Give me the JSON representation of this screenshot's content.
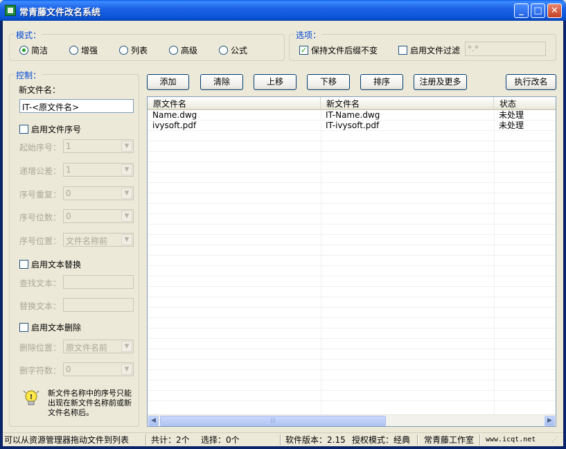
{
  "window": {
    "title": "常青藤文件改名系统",
    "minimize": "_",
    "maximize": "□",
    "close": "✕"
  },
  "mode": {
    "group_label": "模式：",
    "options": [
      "简洁",
      "增强",
      "列表",
      "高级",
      "公式"
    ],
    "selected": "简洁"
  },
  "options": {
    "group_label": "选项：",
    "keep_ext_label": "保持文件后缀不变",
    "keep_ext_checked": true,
    "filter_label": "启用文件过滤",
    "filter_checked": false,
    "filter_value": "*.*"
  },
  "control": {
    "group_label": "控制：",
    "new_name_label": "新文件名：",
    "new_name_value": "IT-<原文件名>",
    "enable_seq_label": "启用文件序号",
    "start_seq_label": "起始序号：",
    "start_seq_value": "1",
    "increment_label": "递增公差：",
    "increment_value": "1",
    "repeat_label": "序号重复：",
    "repeat_value": "0",
    "digits_label": "序号位数：",
    "digits_value": "0",
    "position_label": "序号位置：",
    "position_value": "文件名称前",
    "enable_replace_label": "启用文本替换",
    "find_label": "查找文本：",
    "replace_label": "替换文本：",
    "enable_delete_label": "启用文本删除",
    "delete_pos_label": "删除位置：",
    "delete_pos_value": "原文件名前",
    "delete_count_label": "删字符数：",
    "delete_count_value": "0",
    "hint": "新文件名称中的序号只能出现在新文件名称前或新文件名称后。"
  },
  "toolbar": {
    "add": "添加",
    "clear": "清除",
    "up": "上移",
    "down": "下移",
    "sort": "排序",
    "register": "注册及更多",
    "execute": "执行改名"
  },
  "list": {
    "columns": [
      "原文件名",
      "新文件名",
      "状态"
    ],
    "rows": [
      [
        "Name.dwg",
        "IT-Name.dwg",
        "未处理"
      ],
      [
        "ivysoft.pdf",
        "IT-ivysoft.pdf",
        "未处理"
      ]
    ]
  },
  "statusbar": {
    "hint": "可以从资源管理器拖动文件到列表",
    "total": "共计：2个",
    "selected": "选择：0个",
    "version": "软件版本：2.15",
    "license": "授权模式：经典",
    "studio": "常青藤工作室",
    "website": "www.icqt.net"
  },
  "colors": {
    "title_blue": "#0a5de8",
    "group_label": "#0046d5",
    "check_green": "#21a121"
  }
}
